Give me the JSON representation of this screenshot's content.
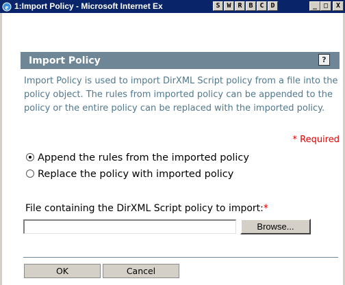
{
  "window": {
    "title": "1:Import Policy - Microsoft Internet Ex",
    "toolbar_buttons": [
      "S",
      "W",
      "R",
      "B",
      "C",
      "D"
    ],
    "controls": {
      "minimize": "_",
      "maximize": "□",
      "close": "X"
    }
  },
  "dialog": {
    "header_title": "Import Policy",
    "help_icon": "?",
    "description": "Import Policy is used to import DirXML Script policy from a file into the policy object.  The rules from imported policy can be appended to the policy or the entire policy can be replaced with the imported policy.",
    "required_note": "* Required",
    "radio_options": [
      {
        "label": "Append the rules from the imported policy",
        "checked": true
      },
      {
        "label": "Replace the policy with imported policy",
        "checked": false
      }
    ],
    "file_field": {
      "label": "File containing the DirXML Script policy to import:",
      "required_marker": "*",
      "value": "",
      "browse_label": "Browse..."
    },
    "buttons": {
      "ok": "OK",
      "cancel": "Cancel"
    }
  },
  "colors": {
    "titlebar": "#0a246a",
    "header": "#6e8696",
    "description_text": "#50788c",
    "required": "#e00000"
  }
}
